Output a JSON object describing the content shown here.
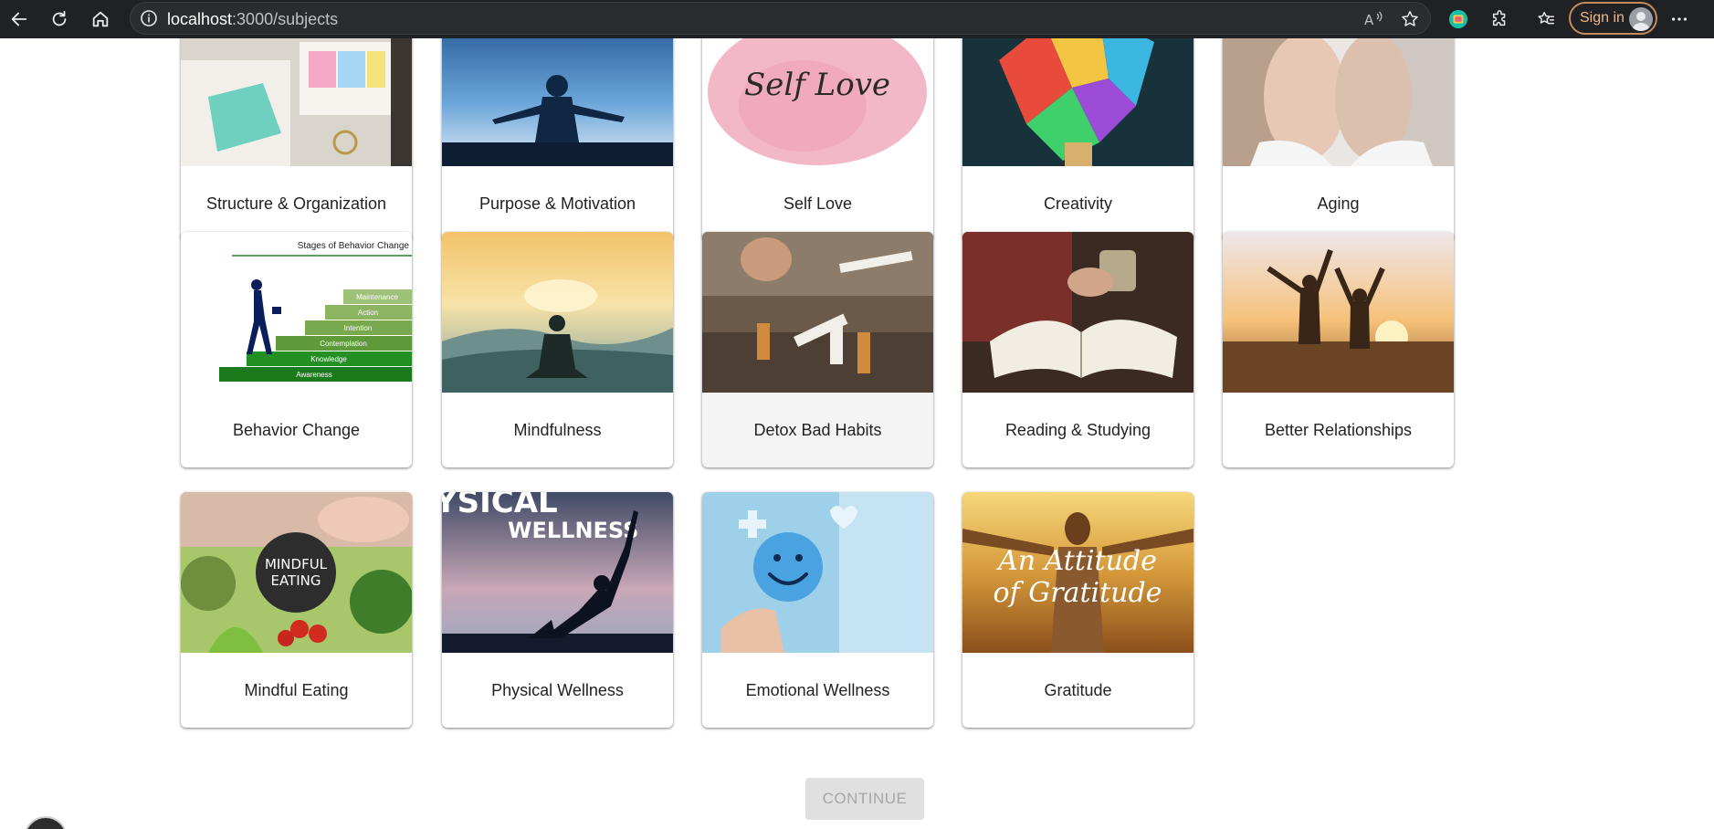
{
  "browser": {
    "url_host": "localhost",
    "url_path": ":3000/subjects",
    "sign_in_label": "Sign in"
  },
  "subjects": [
    {
      "label": "Structure & Organization"
    },
    {
      "label": "Purpose & Motivation"
    },
    {
      "label": "Self Love",
      "image_text": "Self Love"
    },
    {
      "label": "Creativity"
    },
    {
      "label": "Aging"
    },
    {
      "label": "Behavior Change",
      "image_title": "Stages of Behavior Change",
      "image_steps": [
        "Maintenance",
        "Action",
        "Intention",
        "Contemplation",
        "Knowledge",
        "Awareness"
      ]
    },
    {
      "label": "Mindfulness"
    },
    {
      "label": "Detox Bad Habits",
      "state": "hovered"
    },
    {
      "label": "Reading & Studying"
    },
    {
      "label": "Better Relationships"
    },
    {
      "label": "Mindful Eating",
      "image_text": [
        "MINDFUL",
        "EATING"
      ]
    },
    {
      "label": "Physical Wellness",
      "image_text": [
        "YSICAL",
        "WELLNESS"
      ]
    },
    {
      "label": "Emotional Wellness"
    },
    {
      "label": "Gratitude",
      "image_text": [
        "An Attitude",
        "of Gratitude"
      ]
    }
  ],
  "continue_label": "CONTINUE",
  "colors": {
    "chrome_bg": "#202124",
    "signin_border": "#c78a5a",
    "continue_disabled_bg": "#e0e0e0"
  }
}
